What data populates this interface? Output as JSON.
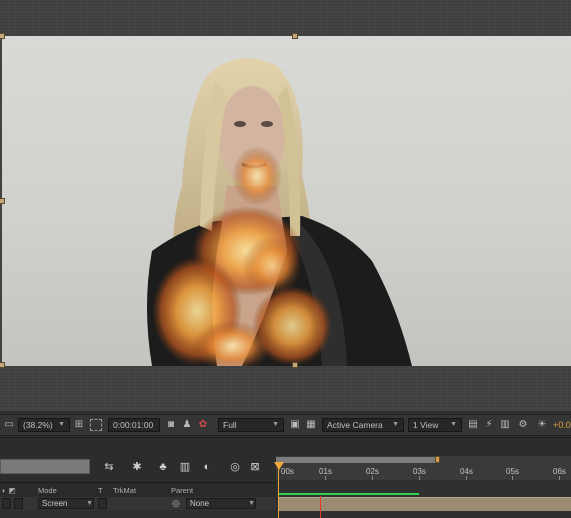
{
  "viewer": {
    "zoom": "(38.2%)",
    "timecode": "0:00:01:00",
    "resolution": "Full",
    "camera": "Active Camera",
    "view_layout": "1 View",
    "exposure": "+0.0",
    "icons": [
      "zoom-dropdown-icon",
      "title-safe-icon",
      "region-icon",
      "snapshot-icon",
      "show-snapshot-icon",
      "color-channel-icon",
      "transparency-grid-icon",
      "flowchart-icon",
      "toggle-pixel-aspect-icon",
      "fast-preview-icon",
      "timeline-icon",
      "reset-exposure-icon"
    ]
  },
  "timeline": {
    "ruler": [
      "00s",
      "01s",
      "02s",
      "03s",
      "04s",
      "05s",
      "06s"
    ],
    "columns": {
      "mode": "Mode",
      "t": "T",
      "trkmat": "TrkMat",
      "parent": "Parent"
    },
    "layer": {
      "mode": "Screen",
      "parent": "None"
    },
    "colors": {
      "playhead": "#f0a838",
      "layer_bar": "#9a8b73",
      "green_line": "#2fd04a",
      "red_line": "#e23a2a"
    }
  }
}
